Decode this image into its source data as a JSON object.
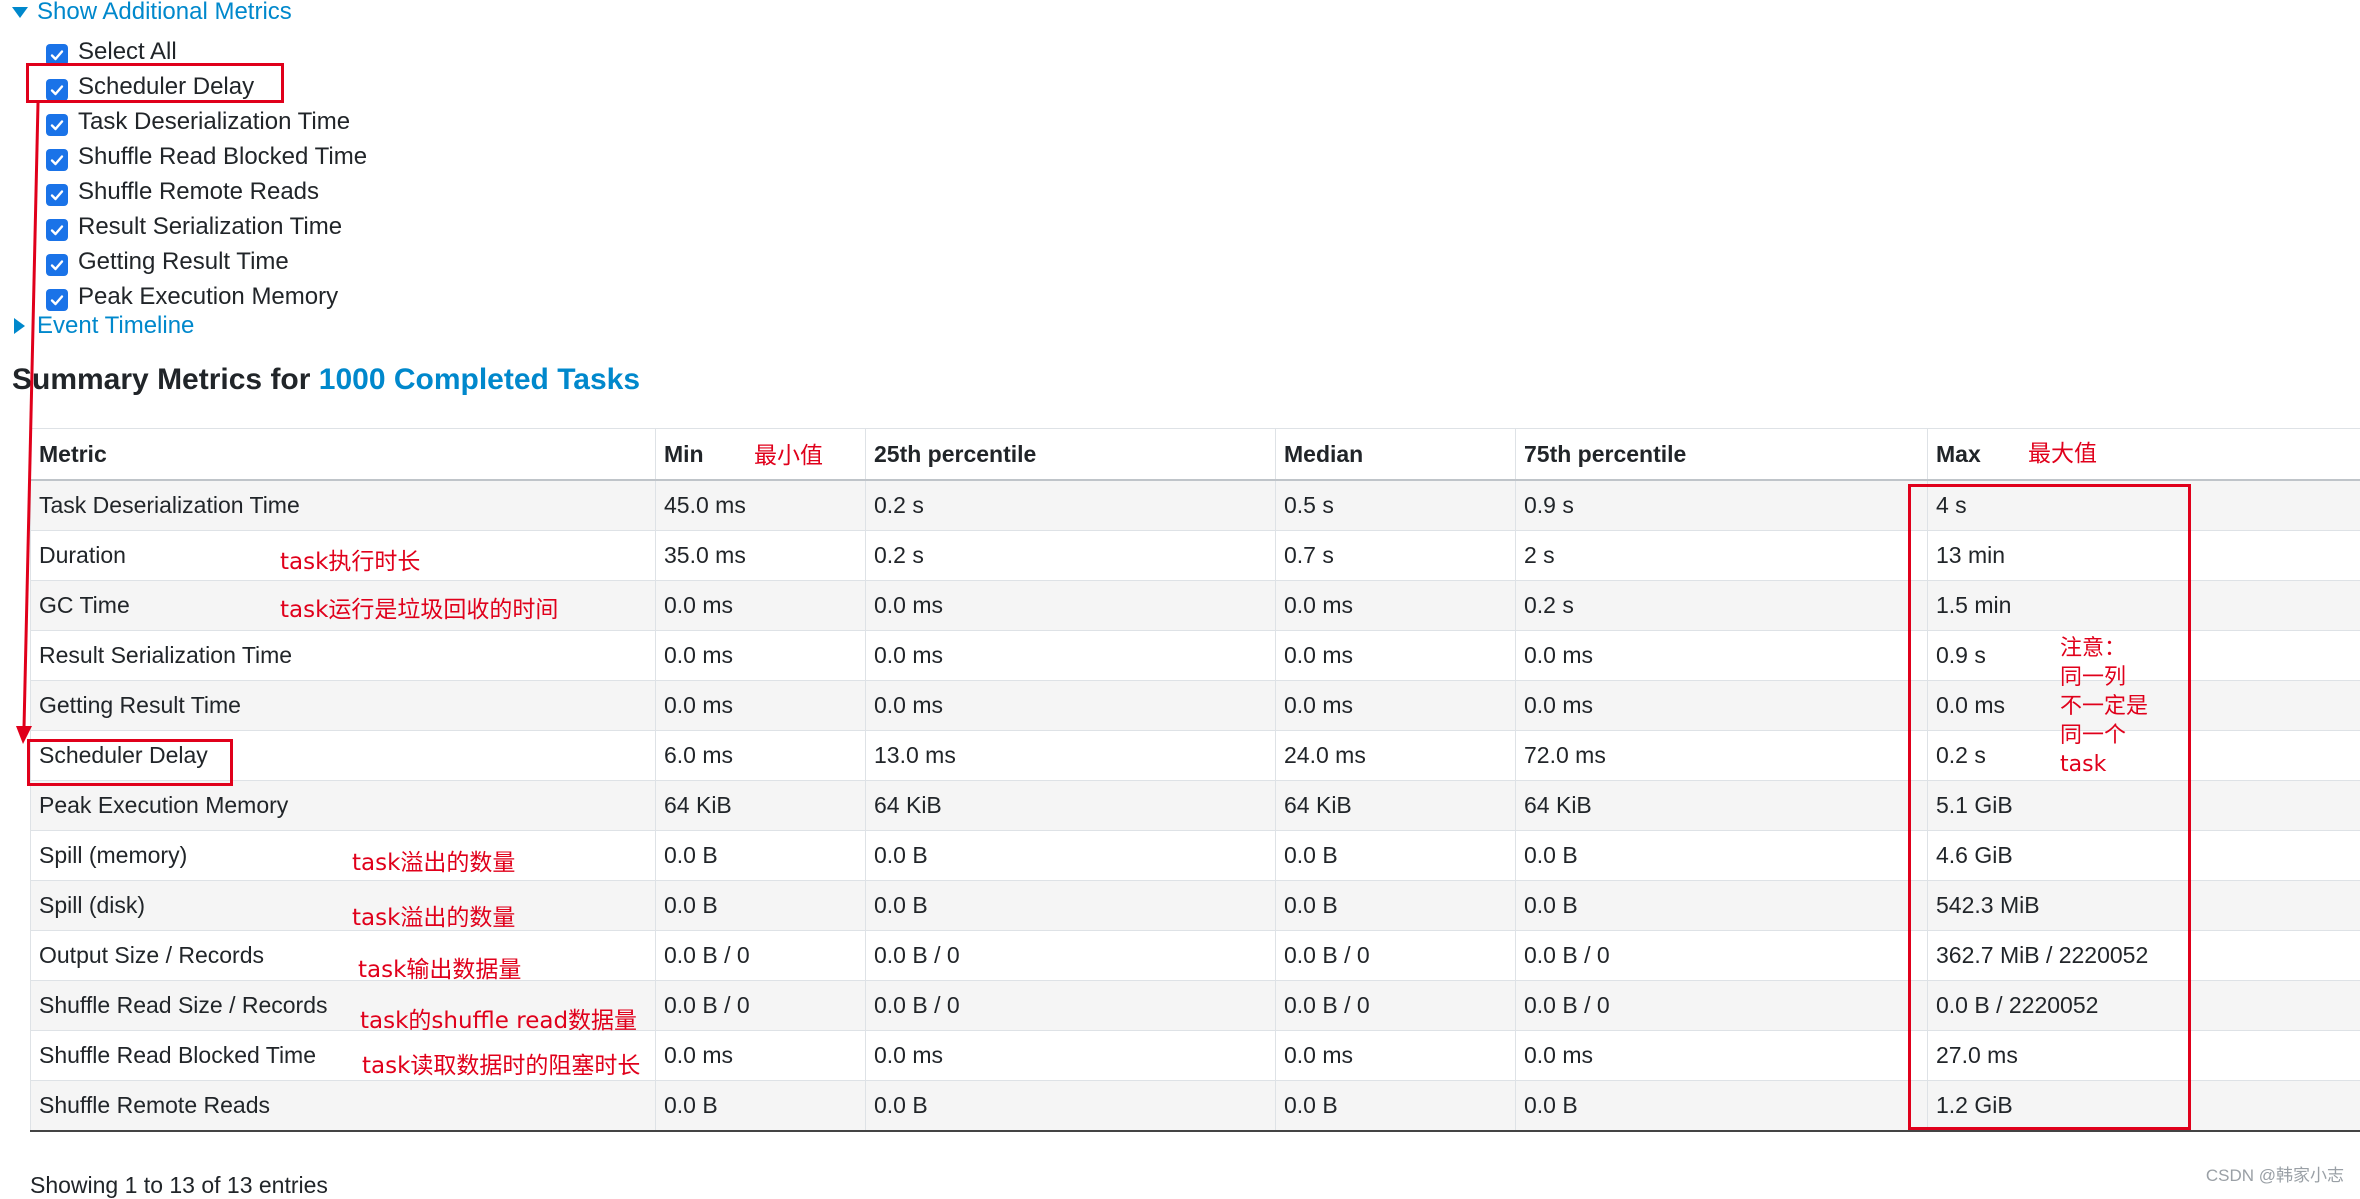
{
  "toggles": {
    "show_additional_metrics": "Show Additional Metrics",
    "event_timeline": "Event Timeline"
  },
  "metric_options": [
    {
      "label": "Select All",
      "checked": true
    },
    {
      "label": "Scheduler Delay",
      "checked": true
    },
    {
      "label": "Task Deserialization Time",
      "checked": true
    },
    {
      "label": "Shuffle Read Blocked Time",
      "checked": true
    },
    {
      "label": "Shuffle Remote Reads",
      "checked": true
    },
    {
      "label": "Result Serialization Time",
      "checked": true
    },
    {
      "label": "Getting Result Time",
      "checked": true
    },
    {
      "label": "Peak Execution Memory",
      "checked": true
    }
  ],
  "summary": {
    "title_prefix": "Summary Metrics for",
    "title_link": "1000 Completed Tasks"
  },
  "table": {
    "headers": [
      "Metric",
      "Min",
      "25th percentile",
      "Median",
      "75th percentile",
      "Max"
    ],
    "rows": [
      [
        "Task Deserialization Time",
        "45.0 ms",
        "0.2 s",
        "0.5 s",
        "0.9 s",
        "4 s"
      ],
      [
        "Duration",
        "35.0 ms",
        "0.2 s",
        "0.7 s",
        "2 s",
        "13 min"
      ],
      [
        "GC Time",
        "0.0 ms",
        "0.0 ms",
        "0.0 ms",
        "0.2 s",
        "1.5 min"
      ],
      [
        "Result Serialization Time",
        "0.0 ms",
        "0.0 ms",
        "0.0 ms",
        "0.0 ms",
        "0.9 s"
      ],
      [
        "Getting Result Time",
        "0.0 ms",
        "0.0 ms",
        "0.0 ms",
        "0.0 ms",
        "0.0 ms"
      ],
      [
        "Scheduler Delay",
        "6.0 ms",
        "13.0 ms",
        "24.0 ms",
        "72.0 ms",
        "0.2 s"
      ],
      [
        "Peak Execution Memory",
        "64 KiB",
        "64 KiB",
        "64 KiB",
        "64 KiB",
        "5.1 GiB"
      ],
      [
        "Spill (memory)",
        "0.0 B",
        "0.0 B",
        "0.0 B",
        "0.0 B",
        "4.6 GiB"
      ],
      [
        "Spill (disk)",
        "0.0 B",
        "0.0 B",
        "0.0 B",
        "0.0 B",
        "542.3 MiB"
      ],
      [
        "Output Size / Records",
        "0.0 B / 0",
        "0.0 B / 0",
        "0.0 B / 0",
        "0.0 B / 0",
        "362.7 MiB / 2220052"
      ],
      [
        "Shuffle Read Size / Records",
        "0.0 B / 0",
        "0.0 B / 0",
        "0.0 B / 0",
        "0.0 B / 0",
        "0.0 B / 2220052"
      ],
      [
        "Shuffle Read Blocked Time",
        "0.0 ms",
        "0.0 ms",
        "0.0 ms",
        "0.0 ms",
        "27.0 ms"
      ],
      [
        "Shuffle Remote Reads",
        "0.0 B",
        "0.0 B",
        "0.0 B",
        "0.0 B",
        "1.2 GiB"
      ]
    ]
  },
  "footer": {
    "entries_info": "Showing 1 to 13 of 13 entries"
  },
  "annotations": {
    "min_label": "最小值",
    "max_label": "最大值",
    "duration_note": "task执行时长",
    "gc_note": "task运行是垃圾回收的时间",
    "spill_memory_note": "task溢出的数量",
    "spill_disk_note": "task溢出的数量",
    "output_note": "task输出数据量",
    "shuffle_read_note": "task的shuffle read数据量",
    "blocked_note": "task读取数据时的阻塞时长",
    "column_note": [
      "注意：",
      "同一列",
      "不一定是",
      "同一个",
      "task"
    ],
    "color": "#e0001b"
  },
  "watermark": "CSDN @韩家小志",
  "colors": {
    "link": "#0088cc",
    "checkbox": "#1a73e8",
    "stripe": "#f5f5f5"
  }
}
